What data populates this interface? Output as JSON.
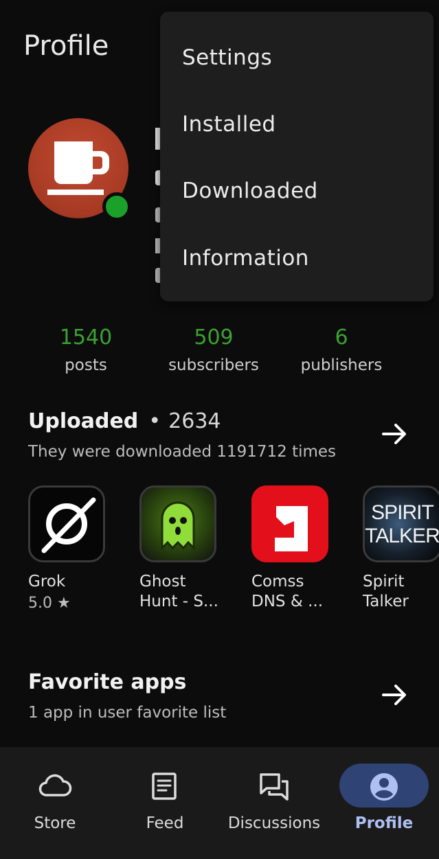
{
  "header": {
    "title": "Profile"
  },
  "profile": {
    "avatar_icon": "coffee-cup-icon",
    "online_status_color": "#1ba12a"
  },
  "stats": [
    {
      "value": "1540",
      "label": "posts"
    },
    {
      "value": "509",
      "label": "subscribers"
    },
    {
      "value": "6",
      "label": "publishers"
    }
  ],
  "uploaded": {
    "title": "Uploaded",
    "separator": "•",
    "count": "2634",
    "subtitle": "They were downloaded 1191712 times",
    "apps": [
      {
        "name": "Grok",
        "rating": "5.0 ★",
        "icon": "grok-icon"
      },
      {
        "name": "Ghost Hunt - S...",
        "icon": "ghost-icon"
      },
      {
        "name": "Comss DNS & ...",
        "icon": "comss-icon"
      },
      {
        "name": "Spirit Talker",
        "icon_text": "SPIRIT TALKER",
        "icon": "spirit-talker-icon"
      }
    ]
  },
  "favorites": {
    "title": "Favorite apps",
    "subtitle": "1 app in user favorite list"
  },
  "menu": {
    "items": [
      "Settings",
      "Installed",
      "Downloaded",
      "Information"
    ]
  },
  "bottom_nav": {
    "items": [
      {
        "label": "Store",
        "icon": "cloud-icon"
      },
      {
        "label": "Feed",
        "icon": "feed-icon"
      },
      {
        "label": "Discussions",
        "icon": "discussions-icon"
      },
      {
        "label": "Profile",
        "icon": "profile-icon",
        "active": true
      }
    ],
    "active_color": "#aebff2",
    "active_pill_color": "#2f4474"
  },
  "colors": {
    "background": "#0c0c0c",
    "stat_green": "#3ba232",
    "menu_bg": "#1e1e1e"
  }
}
